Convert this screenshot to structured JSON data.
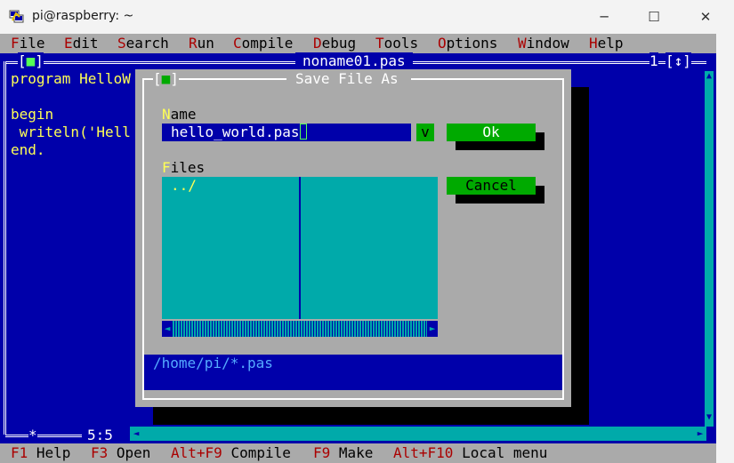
{
  "window": {
    "title": "pi@raspberry: ~",
    "minimize_glyph": "─",
    "maximize_glyph": "☐",
    "close_glyph": "✕"
  },
  "menu": {
    "items": [
      {
        "hot": "F",
        "rest": "ile"
      },
      {
        "hot": "E",
        "rest": "dit"
      },
      {
        "hot": "S",
        "rest": "earch"
      },
      {
        "hot": "R",
        "rest": "un"
      },
      {
        "hot": "C",
        "rest": "ompile"
      },
      {
        "hot": "D",
        "rest": "ebug"
      },
      {
        "hot": "T",
        "rest": "ools"
      },
      {
        "hot": "O",
        "rest": "ptions"
      },
      {
        "hot": "W",
        "rest": "indow"
      },
      {
        "hot": "H",
        "rest": "elp"
      }
    ]
  },
  "editor": {
    "close_box": "[■]",
    "filename": "noname01.pas",
    "window_number": "1",
    "zoom_box": "[↕]",
    "code_lines": [
      "program HelloW",
      "",
      "begin",
      " writeln('Hell",
      "end."
    ],
    "modified_marker": "*",
    "cursor_position": "5:5"
  },
  "dialog": {
    "close_box": "[■]",
    "title": "Save File As",
    "name_label_hot": "N",
    "name_label_rest": "ame",
    "name_value": "hello_world.pas",
    "dropdown_label": "v",
    "ok_label": "Ok",
    "cancel_label": "Cancel",
    "files_label_hot": "F",
    "files_label_rest": "iles",
    "files": [
      "../"
    ],
    "path": "/home/pi/*.pas"
  },
  "statusbar": {
    "items": [
      {
        "key": "F1",
        "label": "Help"
      },
      {
        "key": "F3",
        "label": "Open"
      },
      {
        "key": "Alt+F9",
        "label": "Compile"
      },
      {
        "key": "F9",
        "label": "Make"
      },
      {
        "key": "Alt+F10",
        "label": "Local menu"
      }
    ]
  },
  "colors": {
    "terminal_blue": "#0000aa",
    "gray": "#aaaaaa",
    "cyan": "#00aaaa",
    "green": "#00aa00",
    "hotkey_red": "#aa0000",
    "hotkey_yellow": "#ffff55"
  }
}
